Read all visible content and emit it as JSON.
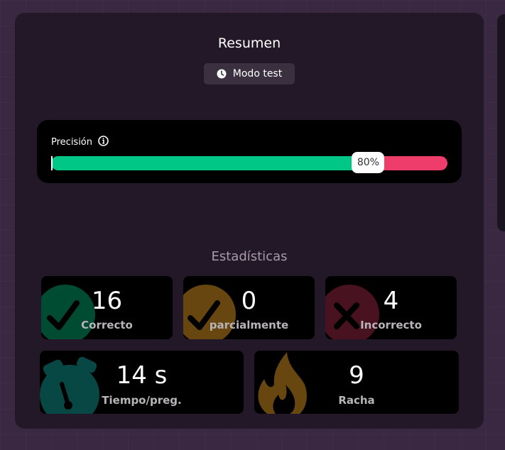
{
  "summary": {
    "title": "Resumen",
    "mode_label": "Modo test",
    "mode_icon": "clock-icon"
  },
  "precision": {
    "label": "Precisión",
    "info_icon": "info-icon",
    "percent": 80,
    "percent_label": "80%",
    "correct_color": "#00c785",
    "incorrect_color": "#ee3d6a"
  },
  "stats": {
    "title": "Estadísticas",
    "correct": {
      "value": "16",
      "label": "Correcto",
      "icon": "check-icon",
      "color": "#00c785"
    },
    "partial": {
      "value": "0",
      "label": "parcialmente",
      "icon": "check-icon",
      "color": "#f5a623"
    },
    "incorrect": {
      "value": "4",
      "label": "Incorrecto",
      "icon": "close-icon",
      "color": "#ee3d6a"
    },
    "time": {
      "value": "14 s",
      "label": "Tiempo/preg.",
      "icon": "stopwatch-icon",
      "color": "#0f8f8a"
    },
    "streak": {
      "value": "9",
      "label": "Racha",
      "icon": "flame-icon",
      "color": "#f5a623"
    }
  }
}
